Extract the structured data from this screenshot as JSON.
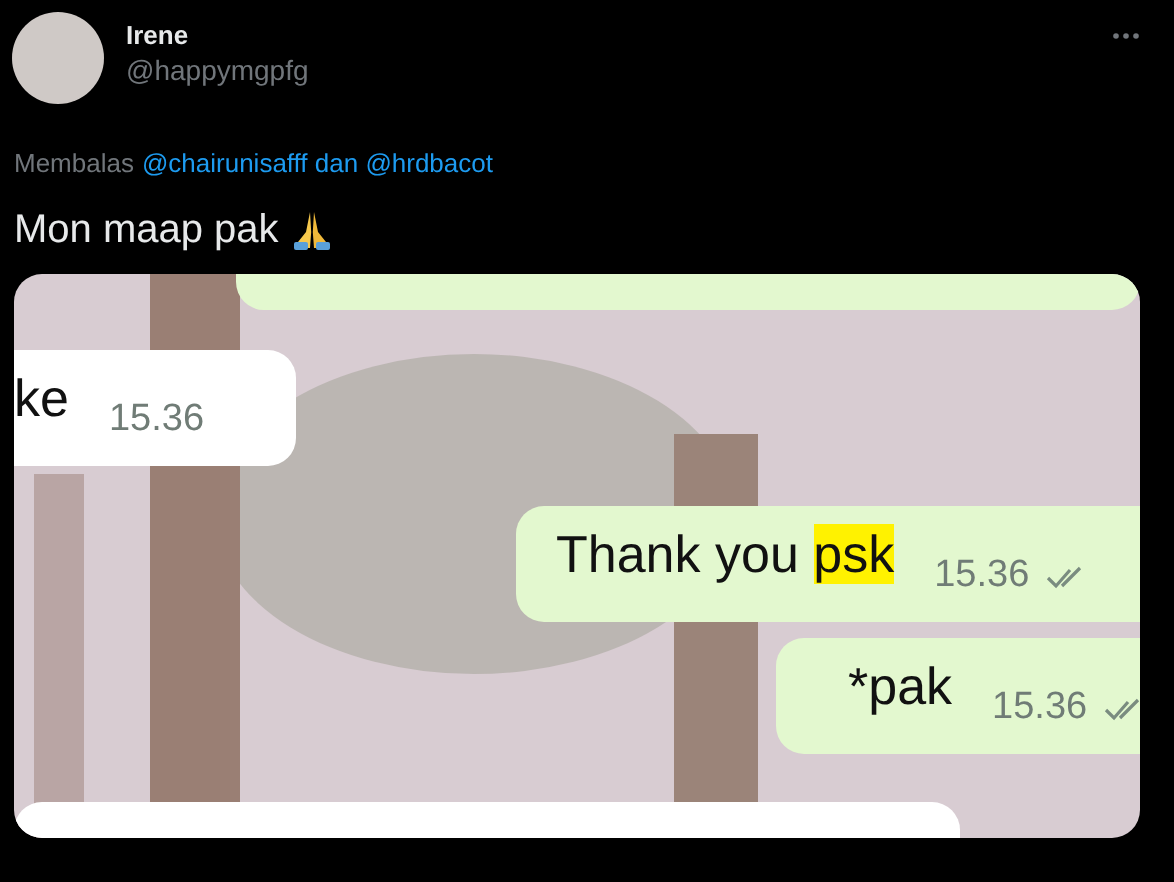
{
  "tweet": {
    "author": {
      "name": "Irene",
      "handle": "@happymgpfg"
    },
    "reply_to": {
      "label": "Membalas",
      "link": "@chairunisafff dan @hrdbacot"
    },
    "text": "Mon maap pak",
    "media": {
      "kind": "chat-screenshot",
      "messages": [
        {
          "kind": "out"
        },
        {
          "kind": "in",
          "parts": [
            {
              "text": "ke",
              "highlighted": false
            }
          ],
          "time": "15.36"
        },
        {
          "kind": "out",
          "parts": [
            {
              "text": "Thank you ",
              "highlighted": false
            },
            {
              "text": "psk",
              "highlighted": true
            }
          ],
          "time": "15.36",
          "read": true
        },
        {
          "kind": "out",
          "parts": [
            {
              "text": "*pak",
              "highlighted": false
            }
          ],
          "time": "15.36",
          "read": true
        },
        {
          "kind": "in"
        }
      ]
    }
  }
}
